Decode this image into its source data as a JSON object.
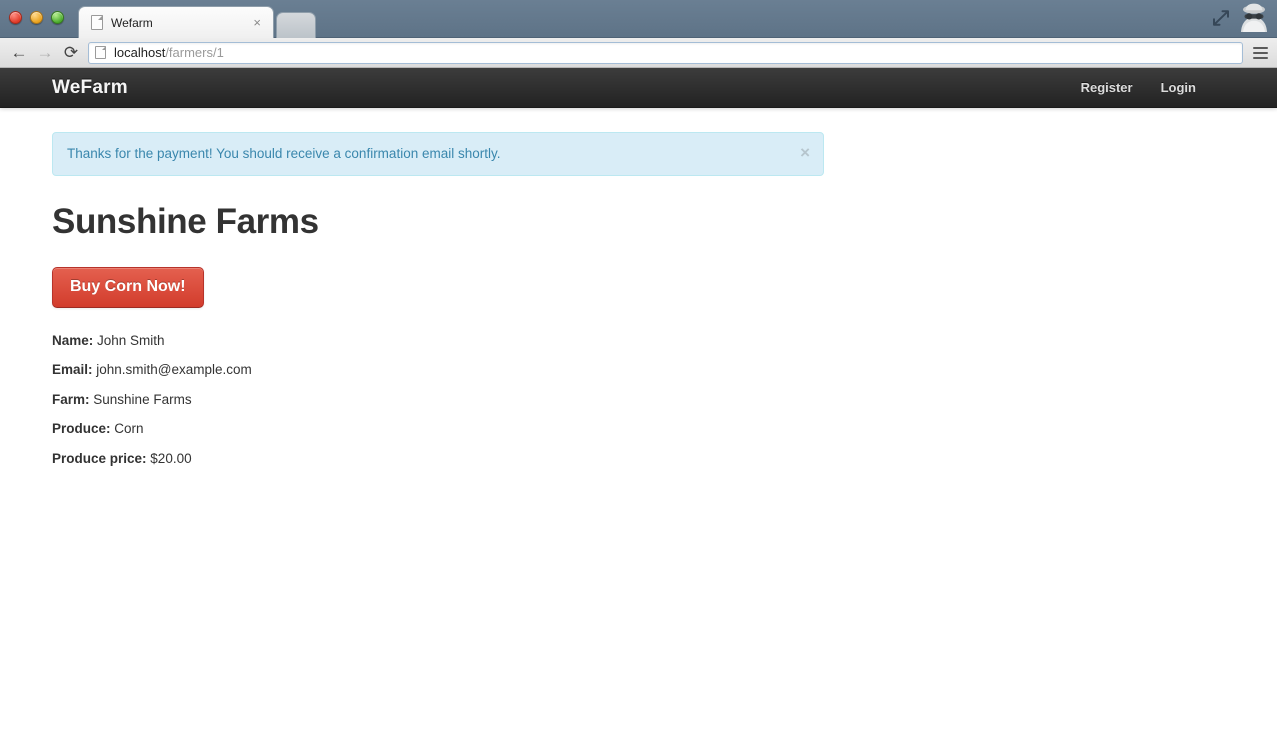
{
  "browser": {
    "window_controls": [
      "close",
      "minimize",
      "zoom"
    ],
    "tab": {
      "title": "Wefarm",
      "close_label": "×",
      "favicon": "page-icon"
    },
    "new_tab_label": "",
    "toolbar": {
      "back_label": "←",
      "forward_label": "→",
      "reload_label": "⟳",
      "url_host": "localhost",
      "url_path": "/farmers/1",
      "menu_label": "menu"
    },
    "incognito_icon": "incognito-spy-icon",
    "fullscreen_icon": "fullscreen-arrows-icon"
  },
  "navbar": {
    "brand": "WeFarm",
    "links": [
      {
        "label": "Register"
      },
      {
        "label": "Login"
      }
    ]
  },
  "alert": {
    "message": "Thanks for the payment! You should receive a confirmation email shortly.",
    "close_label": "×",
    "background": "#d9edf7",
    "border": "#bce8f1",
    "text_color": "#3a87ad"
  },
  "main": {
    "title": "Sunshine Farms",
    "buy_button": {
      "label": "Buy Corn Now!",
      "color": "#d23c2c"
    },
    "details": [
      {
        "label": "Name:",
        "value": "John Smith"
      },
      {
        "label": "Email:",
        "value": "john.smith@example.com"
      },
      {
        "label": "Farm:",
        "value": "Sunshine Farms"
      },
      {
        "label": "Produce:",
        "value": "Corn"
      },
      {
        "label": "Produce price:",
        "value": "$20.00"
      }
    ]
  }
}
